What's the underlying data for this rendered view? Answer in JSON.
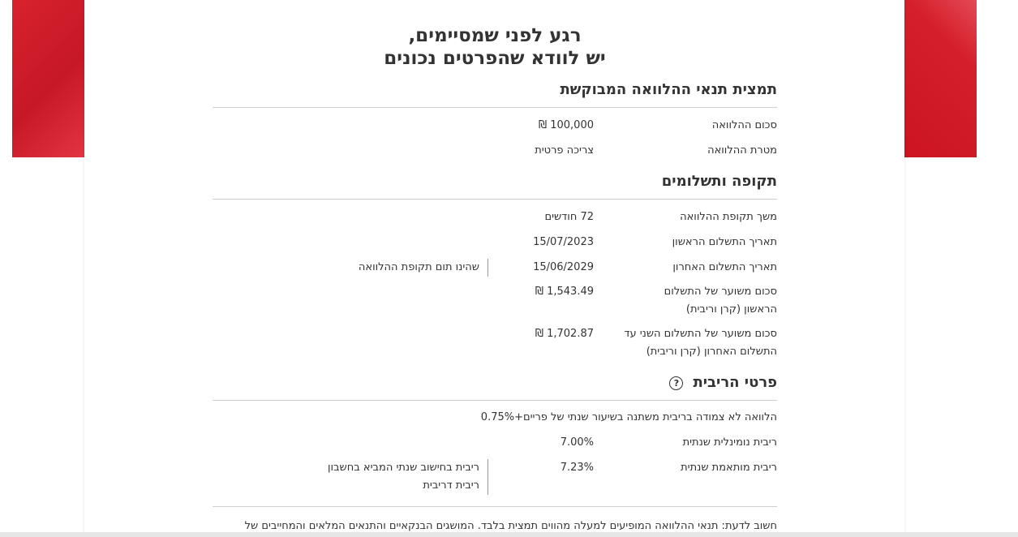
{
  "title": {
    "line1": "רגע לפני שמסיימים,",
    "line2": "יש לוודא שהפרטים נכונים"
  },
  "loan_summary": {
    "heading": "תמצית תנאי ההלוואה המבוקשת",
    "rows": [
      {
        "label": "סכום ההלוואה",
        "value": "₪ 100,000"
      },
      {
        "label": "מטרת ההלוואה",
        "value": "צריכה פרטית"
      }
    ]
  },
  "period": {
    "heading": "תקופה ותשלומים",
    "rows": [
      {
        "label": "משך תקופת ההלוואה",
        "value": "72 חודשים"
      },
      {
        "label": "תאריך התשלום הראשון",
        "value": "15/07/2023"
      },
      {
        "label": "תאריך התשלום האחרון",
        "value": "15/06/2029",
        "note": "שהינו תום תקופת ההלוואה"
      },
      {
        "label": "סכום משוער של התשלום הראשון (קרן וריבית)",
        "value": "₪ 1,543.49"
      },
      {
        "label": "סכום משוער של התשלום השני עד התשלום האחרון (קרן וריבית)",
        "value": "₪ 1,702.87"
      }
    ]
  },
  "interest": {
    "heading": "פרטי הריבית",
    "help_glyph": "?",
    "description": "הלוואה לא צמודה בריבית משתנה בשיעור שנתי של פריים+0.75%",
    "rows": [
      {
        "label": "ריבית נומינלית שנתית",
        "value": "7.00%"
      },
      {
        "label": "ריבית מותאמת שנתית",
        "value": "7.23%",
        "note": "ריבית בחישוב שנתי המביא בחשבון ריבית דריבית"
      }
    ]
  },
  "disclaimer": "חשוב לדעת: תנאי ההלוואה המופיעים למעלה מהווים תמצית בלבד. המושגים הבנקאיים והתנאים המלאים והמחייבים של",
  "colors": {
    "brand_red": "#d51f2c",
    "text": "#333333",
    "divider": "#cfcfcf"
  }
}
